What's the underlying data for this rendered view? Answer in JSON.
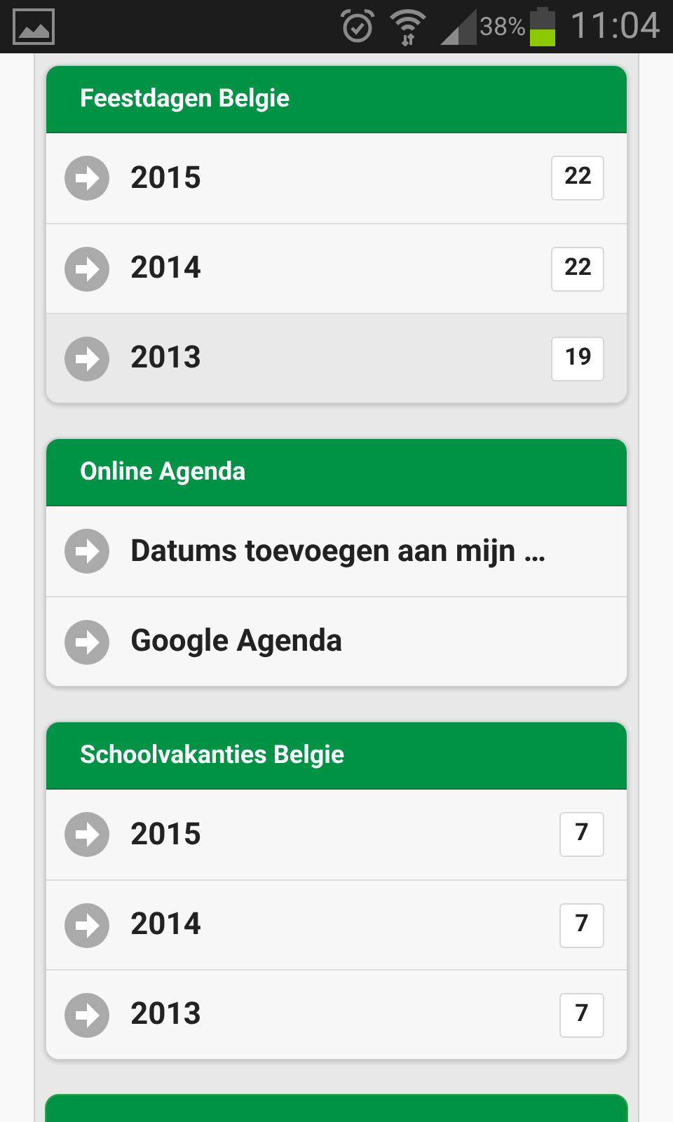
{
  "status_bar": {
    "battery": "38%",
    "time": "11:04"
  },
  "sections": [
    {
      "kind": "list",
      "title": "Feestdagen Belgie",
      "items": [
        {
          "label": "2015",
          "count": "22",
          "selected": false
        },
        {
          "label": "2014",
          "count": "22",
          "selected": false
        },
        {
          "label": "2013",
          "count": "19",
          "selected": true
        }
      ]
    },
    {
      "kind": "list",
      "title": "Online Agenda",
      "items": [
        {
          "label": "Datums toevoegen aan mijn …",
          "selected": false
        },
        {
          "label": "Google Agenda",
          "selected": false
        }
      ]
    },
    {
      "kind": "list",
      "title": "Schoolvakanties Belgie",
      "items": [
        {
          "label": "2015",
          "count": "7",
          "selected": false
        },
        {
          "label": "2014",
          "count": "7",
          "selected": false
        },
        {
          "label": "2013",
          "count": "7",
          "selected": false
        }
      ]
    },
    {
      "kind": "header_only"
    }
  ]
}
